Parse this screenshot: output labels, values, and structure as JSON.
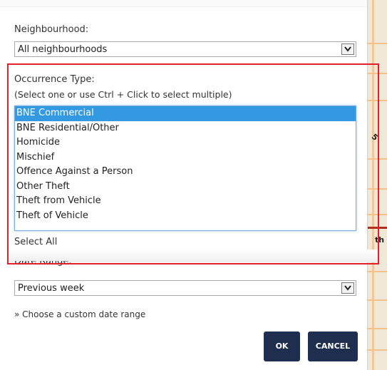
{
  "neighbourhood": {
    "label": "Neighbourhood:",
    "selected": "All neighbourhoods"
  },
  "occurrence": {
    "label": "Occurrence Type:",
    "hint": "(Select one or use Ctrl + Click to select multiple)",
    "options": [
      "BNE Commercial",
      "BNE Residential/Other",
      "Homicide",
      "Mischief",
      "Offence Against a Person",
      "Other Theft",
      "Theft from Vehicle",
      "Theft of Vehicle"
    ],
    "selected_index": 0,
    "select_all": "Select All"
  },
  "date_range": {
    "label": "Date Range:",
    "selected": "Previous week",
    "custom_link": "» Choose a custom date range"
  },
  "buttons": {
    "ok": "OK",
    "cancel": "CANCEL"
  },
  "map": {
    "label_1": "5",
    "label_2": "th"
  },
  "colors": {
    "highlight_border": "#e0202a",
    "selected_option": "#3399e0",
    "button_bg": "#1f2e4e"
  }
}
